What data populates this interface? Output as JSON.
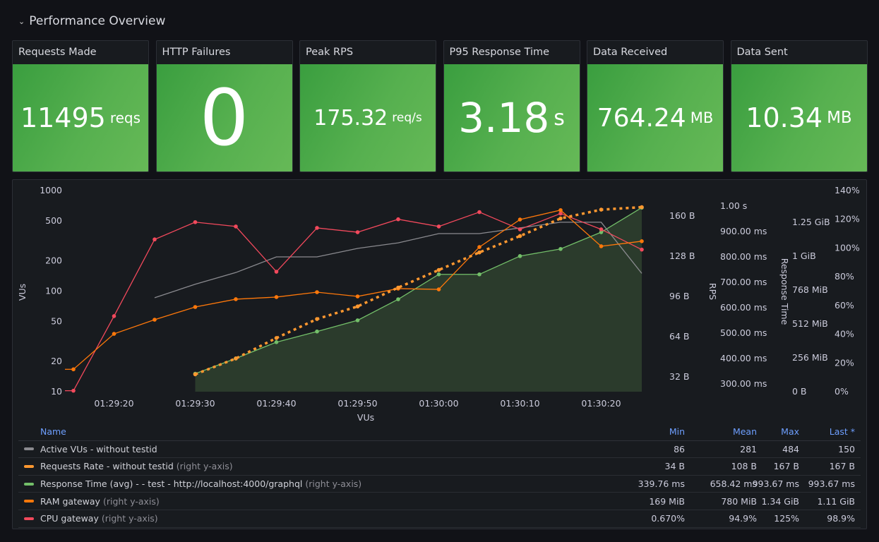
{
  "row": {
    "title": "Performance Overview",
    "icon": "chevron-down-icon"
  },
  "stats": [
    {
      "title": "Requests Made",
      "value": "11495",
      "unit": "reqs"
    },
    {
      "title": "HTTP Failures",
      "value": "0",
      "unit": ""
    },
    {
      "title": "Peak RPS",
      "value": "175.32",
      "unit": "req/s"
    },
    {
      "title": "P95 Response Time",
      "value": "3.18",
      "unit": "s"
    },
    {
      "title": "Data Received",
      "value": "764.24",
      "unit": "MB"
    },
    {
      "title": "Data Sent",
      "value": "10.34",
      "unit": "MB"
    }
  ],
  "colors": {
    "stat_green": "#4caa45",
    "vus": "#8a8a8f",
    "requests": "#ff9830",
    "response": "#73bf69",
    "ram": "#ff780a",
    "cpu": "#f2495c"
  },
  "chart_data": {
    "type": "line",
    "xlabel": "VUs",
    "x": [
      "01:29:15",
      "01:29:20",
      "01:29:25",
      "01:29:30",
      "01:29:35",
      "01:29:40",
      "01:29:45",
      "01:29:50",
      "01:29:55",
      "01:30:00",
      "01:30:05",
      "01:30:10",
      "01:30:15",
      "01:30:20",
      "01:30:25"
    ],
    "x_ticks": [
      "01:29:20",
      "01:29:30",
      "01:29:40",
      "01:29:50",
      "01:30:00",
      "01:30:10",
      "01:30:20"
    ],
    "axes": {
      "vus": {
        "label": "VUs",
        "side": "left",
        "scale": "log",
        "range": [
          10,
          1000
        ],
        "ticks": [
          10,
          20,
          50,
          100,
          200,
          500,
          1000
        ],
        "tick_labels": [
          "10",
          "20",
          "50",
          "100",
          "200",
          "500",
          "1000"
        ]
      },
      "rps": {
        "label": "RPS",
        "side": "right",
        "scale": "linear",
        "range": [
          20.2,
          180.2
        ],
        "ticks": [
          32,
          64,
          96,
          128,
          160
        ],
        "tick_labels": [
          "32 B",
          "64 B",
          "96 B",
          "128 B",
          "160 B"
        ]
      },
      "rt": {
        "label": "Response Time",
        "side": "right",
        "scale": "linear",
        "range": [
          269,
          1061
        ],
        "ticks": [
          300,
          400,
          500,
          600,
          700,
          800,
          900,
          1000
        ],
        "tick_labels": [
          "300.00 ms",
          "400.00 ms",
          "500.00 ms",
          "600.00 ms",
          "700.00 ms",
          "800.00 ms",
          "900.00 ms",
          "1.00 s"
        ]
      },
      "ram": {
        "label": "",
        "side": "right",
        "scale": "linear",
        "range": [
          0,
          1520
        ],
        "ticks": [
          0,
          256,
          512,
          768,
          1024,
          1280
        ],
        "tick_labels": [
          "0 B",
          "256 MiB",
          "512 MiB",
          "768 MiB",
          "1 GiB",
          "1.25 GiB"
        ]
      },
      "cpu": {
        "label": "",
        "side": "right",
        "scale": "linear",
        "range": [
          0,
          140
        ],
        "ticks": [
          0,
          20,
          40,
          60,
          80,
          100,
          120,
          140
        ],
        "tick_labels": [
          "0%",
          "20%",
          "40%",
          "60%",
          "80%",
          "100%",
          "120%",
          "140%"
        ]
      }
    },
    "series": [
      {
        "name": "Active VUs - without testid",
        "axis": "vus",
        "color": "#8a8a8f",
        "style": "line",
        "points": false,
        "values": [
          null,
          null,
          86,
          117,
          153,
          219,
          219,
          266,
          302,
          373,
          373,
          425,
          484,
          484,
          150
        ],
        "stats": {
          "min": "86",
          "mean": "281",
          "max": "484",
          "last": "150"
        }
      },
      {
        "name": "Requests Rate - without testid",
        "hint": "(right y-axis)",
        "axis": "rps",
        "color": "#ff9830",
        "style": "dotted",
        "points": true,
        "values": [
          null,
          null,
          null,
          34,
          46.6,
          62.9,
          78,
          88,
          103,
          117,
          131,
          144,
          158,
          165,
          167
        ],
        "stats": {
          "min": "34 B",
          "mean": "108 B",
          "max": "167 B",
          "last": "167 B"
        }
      },
      {
        "name": "Response Time (avg) - - test - http://localhost:4000/graphql",
        "hint": "(right y-axis)",
        "axis": "rt",
        "color": "#73bf69",
        "style": "area",
        "points": true,
        "values": [
          null,
          null,
          null,
          339.76,
          400,
          464,
          506,
          550,
          633,
          731,
          731,
          803,
          831,
          897,
          993.67
        ],
        "stats": {
          "min": "339.76 ms",
          "mean": "658.42 ms",
          "max": "993.67 ms",
          "last": "993.67 ms"
        }
      },
      {
        "name": "RAM gateway",
        "hint": "(right y-axis)",
        "axis": "ram",
        "color": "#ff780a",
        "style": "line",
        "points": true,
        "values": [
          169,
          437,
          544,
          640,
          699,
          715,
          752,
          720,
          779,
          773,
          1093,
          1301,
          1372,
          1099,
          1137
        ],
        "stats": {
          "min": "169 MiB",
          "mean": "780 MiB",
          "max": "1.34 GiB",
          "last": "1.11 GiB"
        }
      },
      {
        "name": "CPU gateway",
        "hint": "(right y-axis)",
        "axis": "cpu",
        "color": "#f2495c",
        "style": "line",
        "points": true,
        "values": [
          0.67,
          52.6,
          106,
          118,
          115,
          83.5,
          114,
          111,
          120,
          115,
          125,
          113,
          124,
          113,
          98.9
        ],
        "stats": {
          "min": "0.670%",
          "mean": "94.9%",
          "max": "125%",
          "last": "98.9%"
        }
      }
    ]
  },
  "legend": {
    "headers": {
      "name": "Name",
      "min": "Min",
      "mean": "Mean",
      "max": "Max",
      "last": "Last *"
    }
  }
}
